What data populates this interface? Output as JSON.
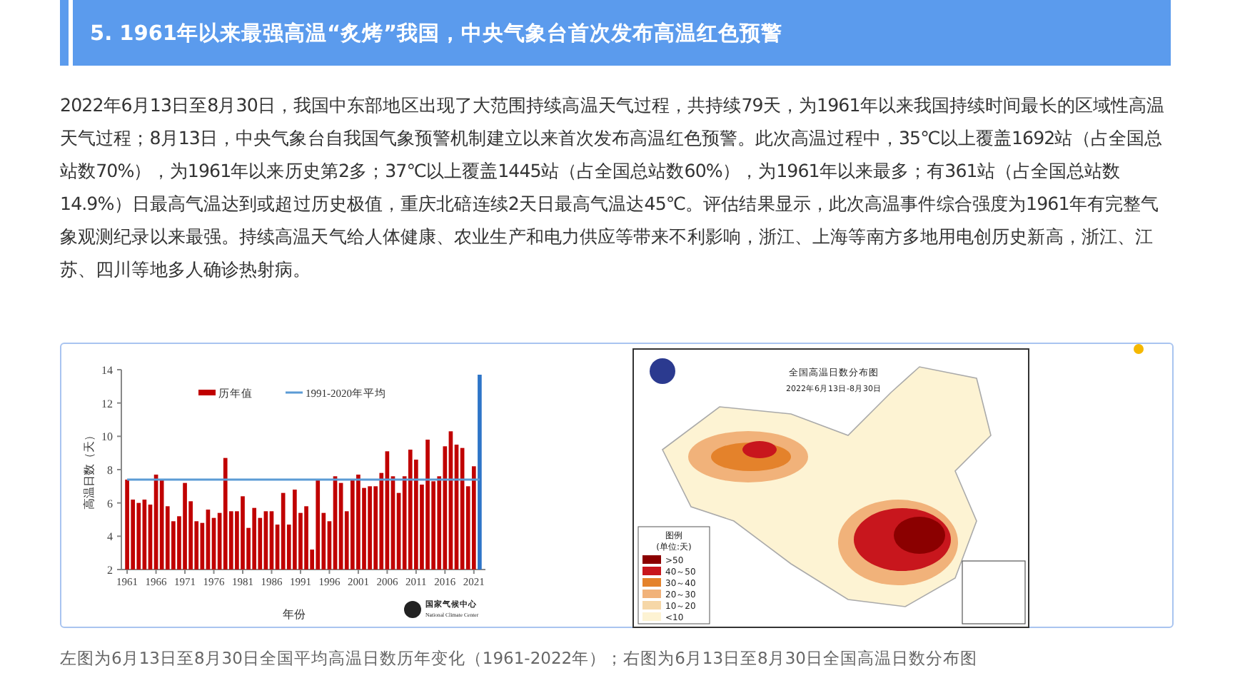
{
  "section_heading": "5. 1961年以来最强高温“炙烤”我国，中央气象台首次发布高温红色预警",
  "paragraph": "2022年6月13日至8月30日，我国中东部地区出现了大范围持续高温天气过程，共持续79天，为1961年以来我国持续时间最长的区域性高温天气过程；8月13日，中央气象台自我国气象预警机制建立以来首次发布高温红色预警。此次高温过程中，35℃以上覆盖1692站（占全国总站数70%），为1961年以来历史第2多；37℃以上覆盖1445站（占全国总站数60%），为1961年以来最多；有361站（占全国总站数14.9%）日最高气温达到或超过历史极值，重庆北碚连续2天日最高气温达45℃。评估结果显示，此次高温事件综合强度为1961年有完整气象观测纪录以来最强。持续高温天气给人体健康、农业生产和电力供应等带来不利影响，浙江、上海等南方多地用电创历史新高，浙江、江苏、四川等地多人确诊热射病。",
  "figure": {
    "left_chart": {
      "chart_data": {
        "type": "bar",
        "xlabel": "年份",
        "ylabel": "高温日数（天）",
        "x": [
          1961,
          1962,
          1963,
          1964,
          1965,
          1966,
          1967,
          1968,
          1969,
          1970,
          1971,
          1972,
          1973,
          1974,
          1975,
          1976,
          1977,
          1978,
          1979,
          1980,
          1981,
          1982,
          1983,
          1984,
          1985,
          1986,
          1987,
          1988,
          1989,
          1990,
          1991,
          1992,
          1993,
          1994,
          1995,
          1996,
          1997,
          1998,
          1999,
          2000,
          2001,
          2002,
          2003,
          2004,
          2005,
          2006,
          2007,
          2008,
          2009,
          2010,
          2011,
          2012,
          2013,
          2014,
          2015,
          2016,
          2017,
          2018,
          2019,
          2020,
          2021,
          2022
        ],
        "series": [
          {
            "name": "历年值",
            "type": "bar",
            "color": "#c00000",
            "values": [
              7.4,
              6.2,
              6.0,
              6.2,
              5.9,
              7.7,
              7.4,
              5.8,
              4.9,
              5.2,
              7.2,
              6.1,
              4.9,
              4.8,
              5.6,
              5.1,
              5.4,
              8.7,
              5.5,
              5.5,
              6.4,
              4.5,
              5.7,
              5.1,
              5.5,
              5.5,
              4.7,
              6.6,
              4.7,
              6.8,
              5.4,
              5.8,
              3.2,
              7.4,
              5.4,
              4.9,
              7.6,
              7.2,
              5.5,
              7.4,
              7.7,
              6.9,
              7.0,
              7.0,
              7.8,
              9.1,
              7.6,
              6.6,
              7.6,
              9.2,
              8.6,
              7.1,
              9.8,
              7.3,
              7.6,
              9.4,
              10.3,
              9.5,
              9.3,
              7.0,
              8.2,
              null
            ]
          },
          {
            "type": "bar",
            "color": "#2e75c8",
            "values": [
              null,
              null,
              null,
              null,
              null,
              null,
              null,
              null,
              null,
              null,
              null,
              null,
              null,
              null,
              null,
              null,
              null,
              null,
              null,
              null,
              null,
              null,
              null,
              null,
              null,
              null,
              null,
              null,
              null,
              null,
              null,
              null,
              null,
              null,
              null,
              null,
              null,
              null,
              null,
              null,
              null,
              null,
              null,
              null,
              null,
              null,
              null,
              null,
              null,
              null,
              null,
              null,
              null,
              null,
              null,
              null,
              null,
              null,
              null,
              null,
              null,
              13.7
            ]
          },
          {
            "name": "1991-2020年平均",
            "type": "line",
            "color": "#5b9bd5",
            "values": [
              7.4,
              7.4,
              7.4,
              7.4,
              7.4,
              7.4,
              7.4,
              7.4,
              7.4,
              7.4,
              7.4,
              7.4,
              7.4,
              7.4,
              7.4,
              7.4,
              7.4,
              7.4,
              7.4,
              7.4,
              7.4,
              7.4,
              7.4,
              7.4,
              7.4,
              7.4,
              7.4,
              7.4,
              7.4,
              7.4,
              7.4,
              7.4,
              7.4,
              7.4,
              7.4,
              7.4,
              7.4,
              7.4,
              7.4,
              7.4,
              7.4,
              7.4,
              7.4,
              7.4,
              7.4,
              7.4,
              7.4,
              7.4,
              7.4,
              7.4,
              7.4,
              7.4,
              7.4,
              7.4,
              7.4,
              7.4,
              7.4,
              7.4,
              7.4,
              7.4,
              7.4,
              7.4
            ]
          }
        ],
        "legend": "top",
        "xlim": [
          1960,
          2023
        ],
        "ylim": [
          2,
          14
        ],
        "yticks": [
          2,
          4,
          6,
          8,
          10,
          12,
          14
        ],
        "xticks": [
          1961,
          1966,
          1971,
          1976,
          1981,
          1986,
          1991,
          1996,
          2001,
          2006,
          2011,
          2016,
          2021
        ]
      },
      "credit": {
        "name": "国家气候中心",
        "english": "National Climate Center"
      }
    },
    "right_map": {
      "title": "全国高温日数分布图",
      "subtitle": "2022年6月13日-8月30日",
      "legend_title": "图例",
      "legend_unit": "(单位:天)",
      "legend": [
        {
          "label": ">50",
          "color": "#8b0000"
        },
        {
          "label": "40～50",
          "color": "#c8161d"
        },
        {
          "label": "30～40",
          "color": "#e4822b"
        },
        {
          "label": "20～30",
          "color": "#f1b27a"
        },
        {
          "label": "10～20",
          "color": "#f6d7a7"
        },
        {
          "label": "<10",
          "color": "#fdf3d3"
        }
      ]
    }
  },
  "caption": "左图为6月13日至8月30日全国平均高温日数历年变化（1961-2022年）；右图为6月13日至8月30日全国高温日数分布图"
}
